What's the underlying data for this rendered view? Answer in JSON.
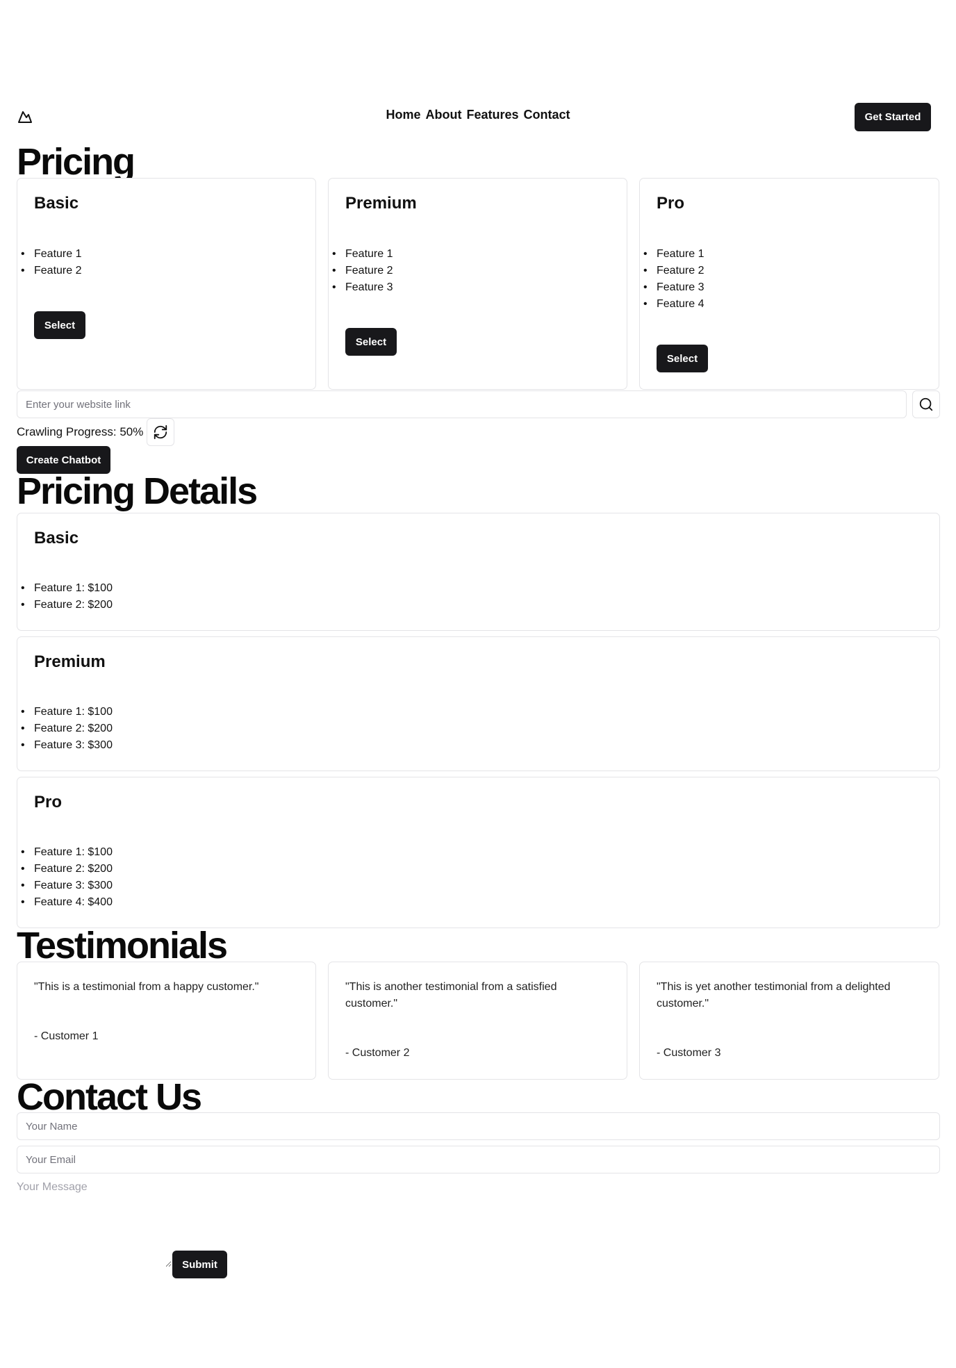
{
  "header": {
    "logo_icon": "mountain-icon",
    "nav": [
      "Home",
      "About",
      "Features",
      "Contact"
    ],
    "cta_label": "Get Started"
  },
  "pricing": {
    "title": "Pricing",
    "plans": [
      {
        "name": "Basic",
        "features": [
          "Feature 1",
          "Feature 2"
        ],
        "button": "Select"
      },
      {
        "name": "Premium",
        "features": [
          "Feature 1",
          "Feature 2",
          "Feature 3"
        ],
        "button": "Select"
      },
      {
        "name": "Pro",
        "features": [
          "Feature 1",
          "Feature 2",
          "Feature 3",
          "Feature 4"
        ],
        "button": "Select"
      }
    ]
  },
  "crawler": {
    "url_placeholder": "Enter your website link",
    "search_icon": "search-icon",
    "progress_label": "Crawling Progress: 50%",
    "progress_value": 0.5,
    "refresh_icon": "refresh-icon",
    "create_label": "Create Chatbot"
  },
  "pricing_details": {
    "title": "Pricing Details",
    "plans": [
      {
        "name": "Basic",
        "features": [
          "Feature 1: $100",
          "Feature 2: $200"
        ]
      },
      {
        "name": "Premium",
        "features": [
          "Feature 1: $100",
          "Feature 2: $200",
          "Feature 3: $300"
        ]
      },
      {
        "name": "Pro",
        "features": [
          "Feature 1: $100",
          "Feature 2: $200",
          "Feature 3: $300",
          "Feature 4: $400"
        ]
      }
    ]
  },
  "testimonials": {
    "title": "Testimonials",
    "items": [
      {
        "quote": "\"This is a testimonial from a happy customer.\"",
        "author": "- Customer 1"
      },
      {
        "quote": "\"This is another testimonial from a satisfied customer.\"",
        "author": "- Customer 2"
      },
      {
        "quote": "\"This is yet another testimonial from a delighted customer.\"",
        "author": "- Customer 3"
      }
    ]
  },
  "contact": {
    "title": "Contact Us",
    "name_placeholder": "Your Name",
    "email_placeholder": "Your Email",
    "message_placeholder": "Your Message",
    "submit_label": "Submit"
  },
  "colors": {
    "button_bg": "#18181b",
    "border": "#e4e4e7"
  }
}
